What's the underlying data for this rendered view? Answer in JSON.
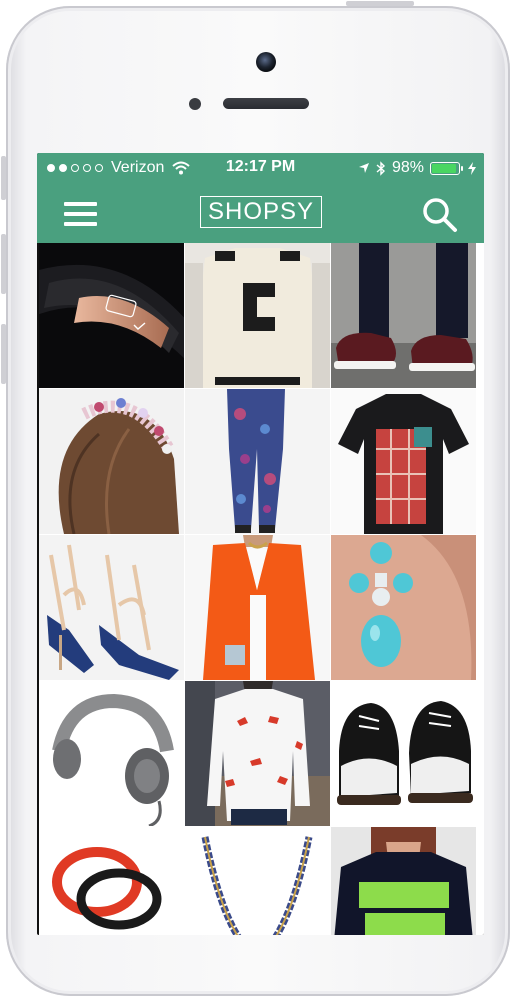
{
  "status_bar": {
    "carrier": "Verizon",
    "time": "12:17 PM",
    "battery": "98%",
    "battery_level": 0.98,
    "signal_bars": 2,
    "icons": [
      "wifi-icon",
      "location-arrow-icon",
      "bluetooth-icon",
      "battery-icon",
      "charging-bolt-icon"
    ]
  },
  "nav": {
    "brand": "SHOPSY",
    "menu_icon": "hamburger-menu-icon",
    "search_icon": "search-icon"
  },
  "colors": {
    "accent": "#4aa07f",
    "battery_fill": "#49d662"
  },
  "products": [
    "fitness-band-rose-gold",
    "letter-c-sweater",
    "burgundy-sneakers",
    "floral-jeweled-headband",
    "printed-leggings",
    "plaid-pocket-tshirt",
    "studded-navy-heels",
    "orange-blazer",
    "turquoise-drop-earrings",
    "grey-headphones",
    "red-print-sweatshirt",
    "studded-black-shoes",
    "red-activity-bands",
    "chain-necklace",
    "game-over-tshirt"
  ]
}
